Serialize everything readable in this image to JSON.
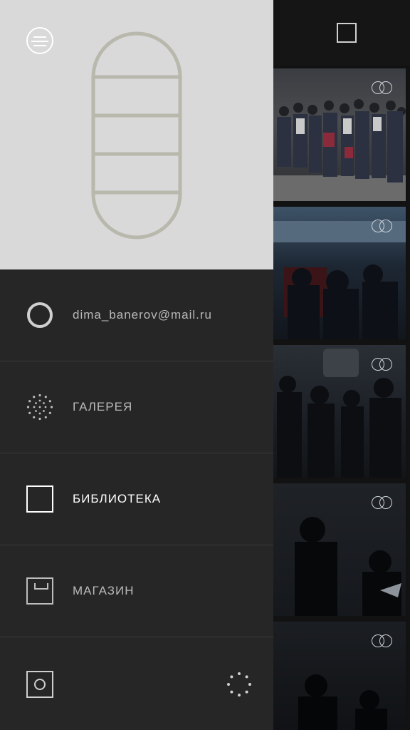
{
  "drawer": {
    "account_email": "dima_banerov@mail.ru",
    "items": [
      {
        "label": "ГАЛЕРЕЯ",
        "icon": "dotted-circle-icon"
      },
      {
        "label": "БИБЛИОТЕКА",
        "icon": "square-icon",
        "active": true
      },
      {
        "label": "МАГАЗИН",
        "icon": "shop-box-icon"
      }
    ]
  },
  "icons": {
    "menu": "menu-icon",
    "account": "circle-icon",
    "settings": "square-circle-icon",
    "loading": "dotted-loader-icon",
    "top_right": "square-icon",
    "rings": "rings-icon"
  },
  "colors": {
    "header_bg": "#d9d9d9",
    "drawer_bg": "#262626",
    "logo_stroke": "#b8b8ac",
    "active_text": "#ffffff",
    "inactive_text": "#b9b9b9"
  }
}
